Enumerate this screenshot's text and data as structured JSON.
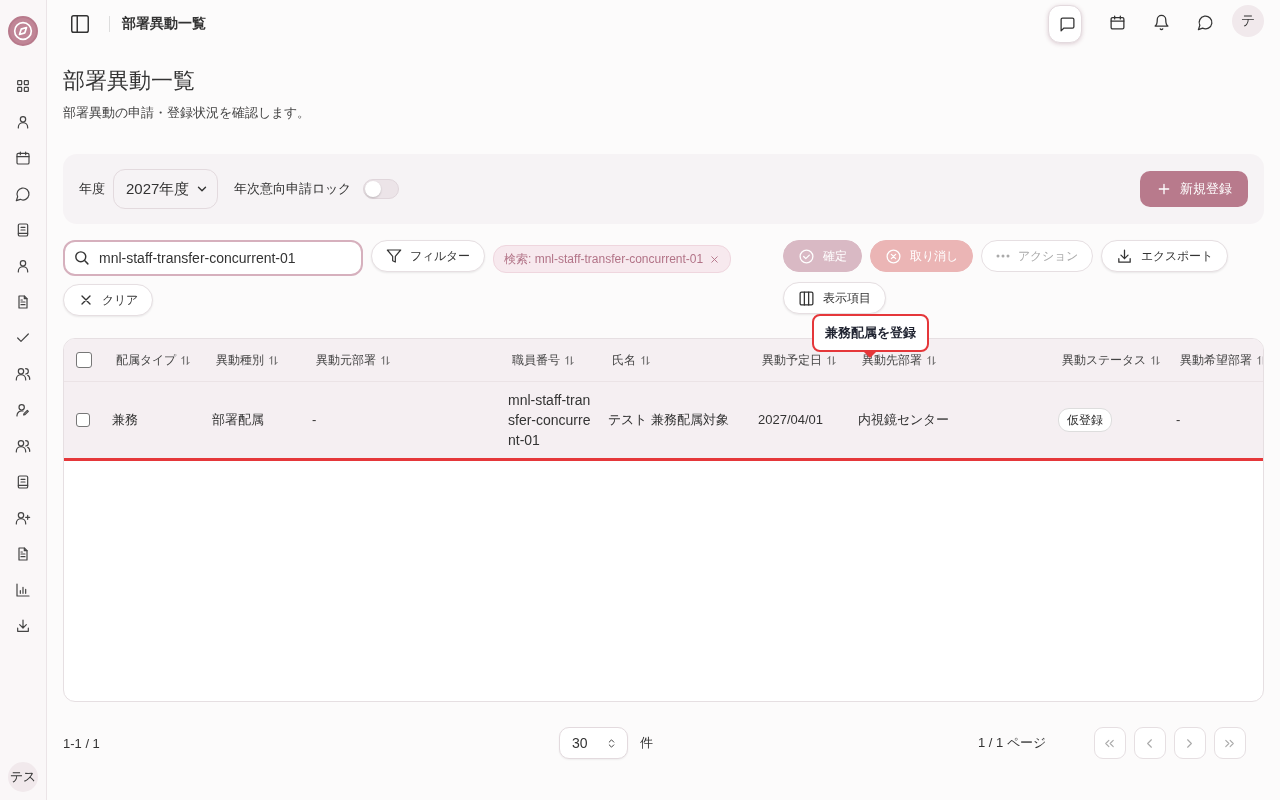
{
  "topbar": {
    "title": "部署異動一覧",
    "buttons": [
      {
        "kind": "feedback",
        "selected": true
      },
      {
        "kind": "calendar",
        "selected": false
      },
      {
        "kind": "bell",
        "selected": false
      },
      {
        "kind": "chat",
        "selected": false
      }
    ],
    "avatar": "テ"
  },
  "sidebar": {
    "items": [
      {
        "kind": "dashboard"
      },
      {
        "kind": "user"
      },
      {
        "kind": "calendar"
      },
      {
        "kind": "chat"
      },
      {
        "kind": "book"
      },
      {
        "kind": "user"
      },
      {
        "kind": "file"
      },
      {
        "kind": "check"
      },
      {
        "kind": "users"
      },
      {
        "kind": "user-edit"
      },
      {
        "kind": "users"
      },
      {
        "kind": "book"
      },
      {
        "kind": "user-plus"
      },
      {
        "kind": "file"
      },
      {
        "kind": "chart"
      },
      {
        "kind": "download"
      }
    ],
    "avatar": "テス"
  },
  "page": {
    "title": "部署異動一覧",
    "subtitle": "部署異動の申請・登録状況を確認します。"
  },
  "controls": {
    "year_label": "年度",
    "year_value": "2027年度",
    "lock_label": "年次意向申請ロック",
    "lock_on": false,
    "new_button": "新規登録"
  },
  "search": {
    "value": "mnl-staff-transfer-concurrent-01"
  },
  "filter_button": "フィルター",
  "search_chip": "検索: mnl-staff-transfer-concurrent-01",
  "clear_button": "クリア",
  "actions": [
    {
      "kind": "confirm",
      "label": "確定",
      "disabled": true
    },
    {
      "kind": "cancel",
      "label": "取り消し",
      "disabled": true
    },
    {
      "kind": "more",
      "label": "アクション",
      "disabled": true
    },
    {
      "kind": "export",
      "label": "エクスポート",
      "disabled": false
    },
    {
      "kind": "columns",
      "label": "表示項目",
      "disabled": false
    }
  ],
  "tooltip": "兼務配属を登録",
  "table": {
    "all_checked": false,
    "columns": [
      {
        "label": "配属タイプ",
        "kind": "text"
      },
      {
        "label": "異動種別",
        "kind": "text"
      },
      {
        "label": "異動元部署",
        "kind": "text"
      },
      {
        "label": "職員番号",
        "kind": "text"
      },
      {
        "label": "氏名",
        "kind": "text"
      },
      {
        "label": "異動予定日",
        "kind": "text"
      },
      {
        "label": "異動先部署",
        "kind": "text"
      },
      {
        "label": "異動ステータス",
        "kind": "badge"
      },
      {
        "label": "異動希望部署",
        "kind": "text"
      }
    ],
    "rows": [
      {
        "checked": false,
        "highlighted": true,
        "cells": [
          "兼務",
          "部署配属",
          "-",
          "mnl-staff-transfer-concurrent-01",
          "テスト 兼務配属対象",
          "2027/04/01",
          "内視鏡センター",
          "仮登録",
          "-"
        ]
      }
    ]
  },
  "pagination": {
    "range": "1-1 / 1",
    "page_size": "30",
    "unit": "件",
    "page_info": "1 / 1 ページ",
    "buttons": [
      {
        "kind": "first",
        "disabled": true
      },
      {
        "kind": "prev",
        "disabled": true
      },
      {
        "kind": "next",
        "disabled": true
      },
      {
        "kind": "last",
        "disabled": true
      }
    ]
  }
}
